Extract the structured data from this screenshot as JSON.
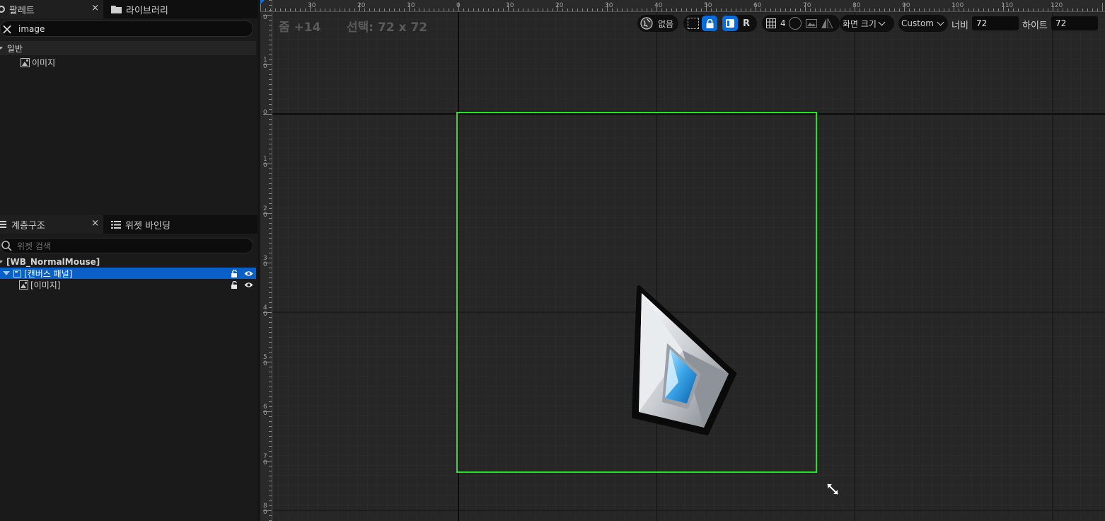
{
  "palette_tabs": {
    "palette": "팔레트",
    "library": "라이브러리",
    "close_glyph": "×"
  },
  "palette_search": {
    "value": "image",
    "clear_glyph": "×"
  },
  "palette_tree": {
    "category": "일반",
    "item": "이미지"
  },
  "hierarchy_tabs": {
    "hierarchy": "계층구조",
    "bindings": "위젯 바인딩",
    "close_glyph": "×"
  },
  "hierarchy_search": {
    "placeholder": "위젯 검색"
  },
  "hierarchy_tree": {
    "root": "[WB_NormalMouse]",
    "canvas": "[캔버스 패널]",
    "image": "[이미지]"
  },
  "viewport": {
    "zoom": "줌 +14",
    "selection": "선택: 72 x 72"
  },
  "toolbar": {
    "localization": "없음",
    "r_label": "R",
    "grid_value": "4",
    "screen_size": "화면 크기",
    "custom": "Custom",
    "width_label": "너비",
    "width_value": "72",
    "height_label": "하이트",
    "height_value": "72"
  },
  "ruler": {
    "top_ticks": [
      "30",
      "20",
      "10",
      "0",
      "10",
      "20",
      "30",
      "40",
      "50",
      "60",
      "70",
      "80",
      "90",
      "100",
      "110",
      "120"
    ],
    "left_ticks": [
      "0",
      "1\n0",
      "0",
      "1\n0",
      "2\n0",
      "3\n0",
      "4\n0",
      "5\n0",
      "6\n0",
      "7\n0",
      "8\n0"
    ]
  },
  "colors": {
    "selection_outline": "#22e622",
    "selected_row": "#0a60c8",
    "accent_blue": "#0a6cd8",
    "grid_major": "#111111",
    "grid_minor": "#2e2e2e",
    "canvas_bg": "#262626"
  },
  "icons": {
    "palette_tab": "palette-icon",
    "library_tab": "folder-icon",
    "hierarchy_tab": "hierarchy-icon",
    "bindings_tab": "list-icon",
    "lock": "lock-icon",
    "eye": "eye-icon",
    "globe": "globe-icon",
    "resize": "resize-arrow-icon"
  }
}
